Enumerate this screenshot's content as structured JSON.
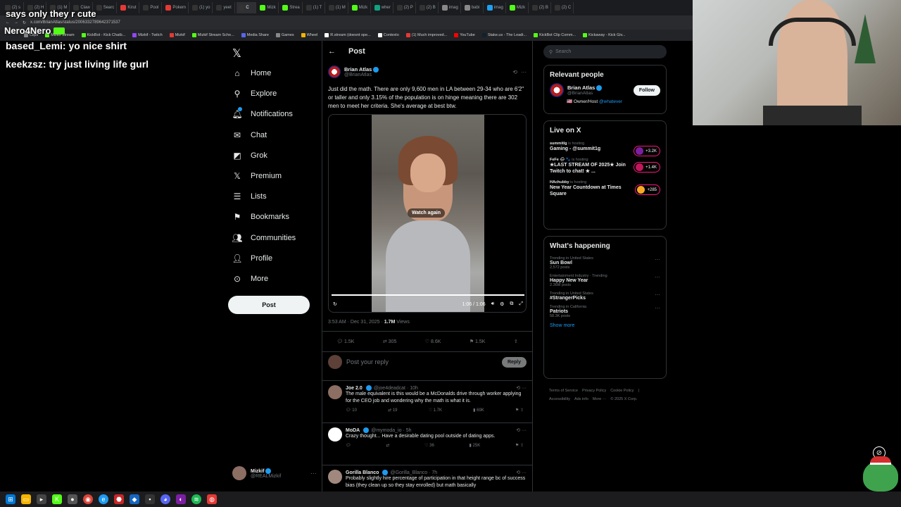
{
  "browser": {
    "tabs": [
      {
        "label": "(2) s",
        "color": "#333",
        "active": false
      },
      {
        "label": "(2) H",
        "color": "#333",
        "active": false
      },
      {
        "label": "(1) M",
        "color": "#333",
        "active": false
      },
      {
        "label": "Claw",
        "color": "#333",
        "active": false
      },
      {
        "label": "Searc",
        "color": "#333",
        "active": false
      },
      {
        "label": "Kirut",
        "color": "#e53935",
        "active": false
      },
      {
        "label": "Pool",
        "color": "#333",
        "active": false
      },
      {
        "label": "Pokem",
        "color": "#e53935",
        "active": false
      },
      {
        "label": "(1) yo",
        "color": "#333",
        "active": false
      },
      {
        "label": "yeet",
        "color": "#333",
        "active": false
      },
      {
        "label": "C",
        "color": "#333",
        "active": true
      },
      {
        "label": "Mizk",
        "color": "#53fc18",
        "active": false
      },
      {
        "label": "Strea",
        "color": "#53fc18",
        "active": false
      },
      {
        "label": "(1) T",
        "color": "#333",
        "active": false
      },
      {
        "label": "(1) M",
        "color": "#333",
        "active": false
      },
      {
        "label": "Mizk",
        "color": "#53fc18",
        "active": false
      },
      {
        "label": "wher",
        "color": "#10a37f",
        "active": false
      },
      {
        "label": "(2) P",
        "color": "#333",
        "active": false
      },
      {
        "label": "(2) B",
        "color": "#333",
        "active": false
      },
      {
        "label": "imag",
        "color": "#888",
        "active": false
      },
      {
        "label": "babi",
        "color": "#888",
        "active": false
      },
      {
        "label": "imag",
        "color": "#1da1f2",
        "active": false
      },
      {
        "label": "Mizk",
        "color": "#53fc18",
        "active": false
      },
      {
        "label": "(2) B",
        "color": "#333",
        "active": false
      },
      {
        "label": "(2) C",
        "color": "#333",
        "active": false
      }
    ],
    "url": "x.com/BrianAtlas/status/2006332789642371537",
    "bookmarks": [
      {
        "label": "Clips",
        "color": "#888"
      },
      {
        "label": "Mizkif Stream",
        "color": "#53fc18"
      },
      {
        "label": "KickBot - Kick Chatb...",
        "color": "#53fc18"
      },
      {
        "label": "Mizkif - Twitch",
        "color": "#9146ff"
      },
      {
        "label": "Mizkif",
        "color": "#e53935"
      },
      {
        "label": "Mizkif Stream Sche...",
        "color": "#53fc18"
      },
      {
        "label": "Media Share",
        "color": "#5865f2"
      },
      {
        "label": "Games",
        "color": "#888"
      },
      {
        "label": "Wheel",
        "color": "#f4b400"
      },
      {
        "label": "R.stream (doesnt ope...",
        "color": "#fff"
      },
      {
        "label": "Contexto",
        "color": "#fff"
      },
      {
        "label": "(1) Much improved...",
        "color": "#e53935"
      },
      {
        "label": "YouTube",
        "color": "#ff0000"
      },
      {
        "label": "Stake.us - The Leadi...",
        "color": "#0f212e"
      },
      {
        "label": "KickBot Clip Comm...",
        "color": "#53fc18"
      },
      {
        "label": "Kickaway - Kick Giv...",
        "color": "#53fc18"
      }
    ]
  },
  "overlay": {
    "top_partial": "says only they r cute",
    "streamer_name": "Nero4Nero",
    "chat": [
      {
        "user": "based_Lemi:",
        "msg": "yo nice shirt"
      },
      {
        "user": "keekzsz:",
        "msg": "try just living life gurl"
      }
    ]
  },
  "nav": {
    "items": [
      {
        "label": "Home",
        "icon": "home-icon",
        "glyph": "⌂"
      },
      {
        "label": "Explore",
        "icon": "search-icon",
        "glyph": "⚲"
      },
      {
        "label": "Notifications",
        "icon": "bell-icon",
        "glyph": "🔔︎"
      },
      {
        "label": "Chat",
        "icon": "mail-icon",
        "glyph": "✉"
      },
      {
        "label": "Grok",
        "icon": "grok-icon",
        "glyph": "◩"
      },
      {
        "label": "Premium",
        "icon": "x-icon",
        "glyph": "𝕏"
      },
      {
        "label": "Lists",
        "icon": "list-icon",
        "glyph": "☰"
      },
      {
        "label": "Bookmarks",
        "icon": "bookmark-icon",
        "glyph": "⚑"
      },
      {
        "label": "Communities",
        "icon": "people-icon",
        "glyph": "👥︎"
      },
      {
        "label": "Profile",
        "icon": "person-icon",
        "glyph": "👤︎"
      },
      {
        "label": "More",
        "icon": "more-circle-icon",
        "glyph": "⊙"
      }
    ],
    "post_button": "Post",
    "account": {
      "name": "Mizkif",
      "handle": "@REALMizkif"
    }
  },
  "post": {
    "header": "Post",
    "author": {
      "name": "Brian Atlas",
      "handle": "@BrianAtlas"
    },
    "text": "Just did the math. There are only 9,600 men in LA between 29-34 who are 6'2\" or taller and only 3.15% of the population is on hinge meaning there are 302 men to meet her criteria. She's average at best btw.",
    "video": {
      "overlay": "Watch again",
      "time": "1:06 / 1:06"
    },
    "timestamp": "3:53 AM · Dec 31, 2025 · ",
    "views": "1.7M",
    "views_label": " Views",
    "stats": {
      "replies": "1.5K",
      "reposts": "305",
      "likes": "8.6K",
      "bookmarks": "1.5K"
    },
    "reply_placeholder": "Post your reply",
    "reply_button": "Reply"
  },
  "replies": [
    {
      "name": "Joe 2.0",
      "handle": "@joe4deadcat · 10h",
      "text": "The male equivalent is this would be a McDonalds drive through worker applying for the CEO job and wondering why the math is what it is.",
      "replies": "10",
      "reposts": "19",
      "likes": "1.7K",
      "views": "69K",
      "avatar": "#8d6e63"
    },
    {
      "name": "MoDA",
      "handle": "@mymoda_io · 5h",
      "text": "Crazy thought... Have a desirable dating pool outside of dating apps.",
      "replies": "",
      "reposts": "",
      "likes": "36",
      "views": "25K",
      "avatar": "#ffffff"
    },
    {
      "name": "Gorilla Blanco",
      "handle": "@Gorilla_Blanco · 7h",
      "text": "Probably slightly hire percentage of participation in that height range bc of success bias (they clean up so they stay enrolled) but math basically",
      "replies": "",
      "reposts": "",
      "likes": "",
      "views": "",
      "avatar": "#a1887f"
    }
  ],
  "search": {
    "placeholder": "Search"
  },
  "relevant": {
    "title": "Relevant people",
    "person": {
      "name": "Brian Atlas",
      "handle": "@BrianAtlas",
      "bio": "🇺🇸 Owner/Host ",
      "bio_link": "@whatever"
    },
    "follow": "Follow"
  },
  "live": {
    "title": "Live on X",
    "items": [
      {
        "host": "summitlg",
        "hosting": " is hosting",
        "title": "Gaming - @summit1g",
        "count": "+3.2K",
        "color": "#7b1fa2"
      },
      {
        "host": "FeFe 🌧 🐾",
        "hosting": " is hosting",
        "title": "★LAST STREAM OF 2025★ Join Twitch to chat! ★ ...",
        "count": "+1.4K",
        "color": "#c2185b"
      },
      {
        "host": "HAchubby",
        "hosting": " is hosting",
        "title": "New Year Countdown at Times Square",
        "count": "+285",
        "color": "#f9a825"
      }
    ]
  },
  "happening": {
    "title": "What's happening",
    "trends": [
      {
        "context": "Trending in United States",
        "name": "Sun Bowl",
        "count": "2,572 posts"
      },
      {
        "context": "Entertainment Industry · Trending",
        "name": "Happy New Year",
        "count": "2.36M posts"
      },
      {
        "context": "Trending in United States",
        "name": "#StrangerPicks",
        "count": ""
      },
      {
        "context": "Trending in California",
        "name": "Patriots",
        "count": "58.3K posts"
      }
    ],
    "show_more": "Show more"
  },
  "footer": {
    "line1": [
      "Terms of Service",
      "Privacy Policy",
      "Cookie Policy",
      "|"
    ],
    "line2": [
      "Accessibility",
      "Ads info",
      "More ···",
      "© 2025 X Corp."
    ]
  },
  "colors": {
    "accent": "#1d9bf0",
    "live": "#f91880",
    "bg": "#000000",
    "border": "#2f3336"
  }
}
